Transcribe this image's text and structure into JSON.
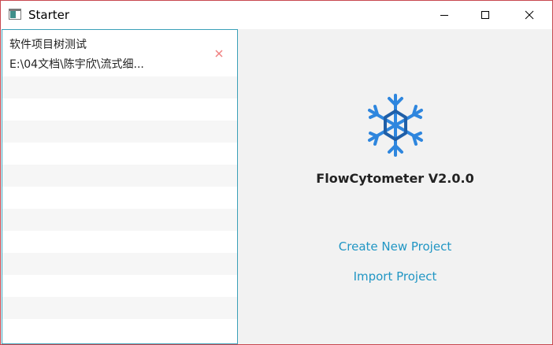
{
  "window": {
    "title": "Starter"
  },
  "recent_projects": [
    {
      "name": "软件项目树测试",
      "path": "E:\\04文档\\陈宇欣\\流式细..."
    }
  ],
  "main": {
    "app_name": "FlowCytometer V2.0.0",
    "create_label": "Create New Project",
    "import_label": "Import Project"
  },
  "icons": {
    "app": "app-window-icon",
    "logo": "snowflake-icon",
    "remove": "close-x-icon"
  },
  "colors": {
    "accent": "#2196c4",
    "logo_outer": "#2e86de",
    "logo_inner": "#1f5fa8",
    "remove": "#f08080",
    "selection_border": "#3aa0b8",
    "right_background": "#f2f2f2"
  }
}
